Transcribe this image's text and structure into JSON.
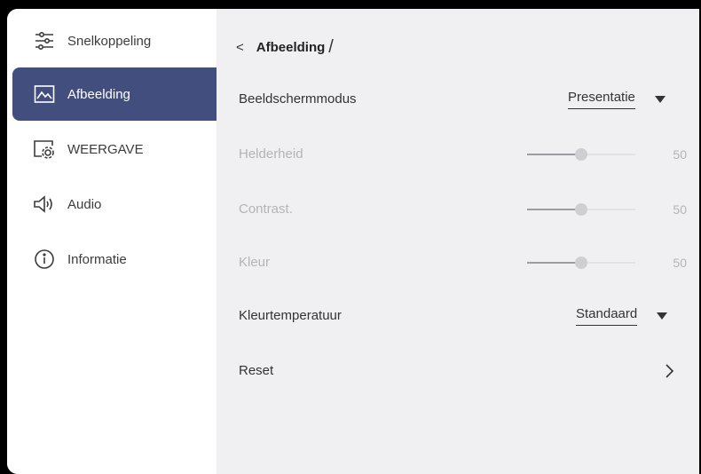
{
  "sidebar": {
    "items": [
      {
        "label": "Snelkoppeling",
        "icon": "sliders-icon",
        "active": false
      },
      {
        "label": "Afbeelding",
        "icon": "image-icon",
        "active": true
      },
      {
        "label": "WEERGAVE",
        "icon": "display-settings-icon",
        "active": false
      },
      {
        "label": "Audio",
        "icon": "speaker-icon",
        "active": false
      },
      {
        "label": "Informatie",
        "icon": "info-icon",
        "active": false
      }
    ]
  },
  "header": {
    "back_glyph": "<",
    "title": "Afbeelding",
    "separator": "/"
  },
  "settings": {
    "picture_mode": {
      "label": "Beeldschermmodus",
      "value": "Presentatie"
    },
    "brightness": {
      "label": "Helderheid",
      "value": "50",
      "level": 0.5
    },
    "contrast": {
      "label": "Contrast.",
      "value": "50",
      "level": 0.5
    },
    "color": {
      "label": "Kleur",
      "value": "50",
      "level": 0.5
    },
    "color_temperature": {
      "label": "Kleurtemperatuur",
      "value": "Standaard"
    },
    "reset": {
      "label": "Reset"
    }
  },
  "colors": {
    "accent": "#424e7e",
    "content_background": "#f0f0f2",
    "disabled_text": "#b4b4b8"
  }
}
